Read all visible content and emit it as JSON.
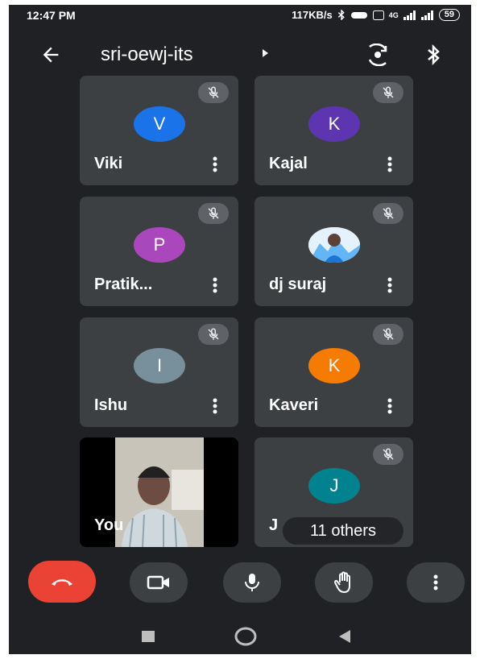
{
  "status": {
    "time": "12:47 PM",
    "network_speed": "117KB/s",
    "network_type": "4G",
    "battery": "59"
  },
  "header": {
    "meeting_name": "sri-oewj-its"
  },
  "participants": [
    {
      "name": "Viki",
      "initial": "V",
      "avatar_color": "#1a73e8",
      "muted": true
    },
    {
      "name": "Kajal",
      "initial": "K",
      "avatar_color": "#5e35b1",
      "muted": true
    },
    {
      "name": "Pratik...",
      "initial": "P",
      "avatar_color": "#ab47bc",
      "muted": true
    },
    {
      "name": "dj suraj",
      "initial": "",
      "avatar_color": "#90caf9",
      "muted": true
    },
    {
      "name": "Ishu",
      "initial": "I",
      "avatar_color": "#78909c",
      "muted": true
    },
    {
      "name": "Kaveri",
      "initial": "K",
      "avatar_color": "#f57c00",
      "muted": true
    },
    {
      "name": "J",
      "initial": "J",
      "avatar_color": "#00838f",
      "muted": true
    }
  ],
  "self_tile": {
    "name": "You"
  },
  "others": {
    "label": "11 others"
  }
}
